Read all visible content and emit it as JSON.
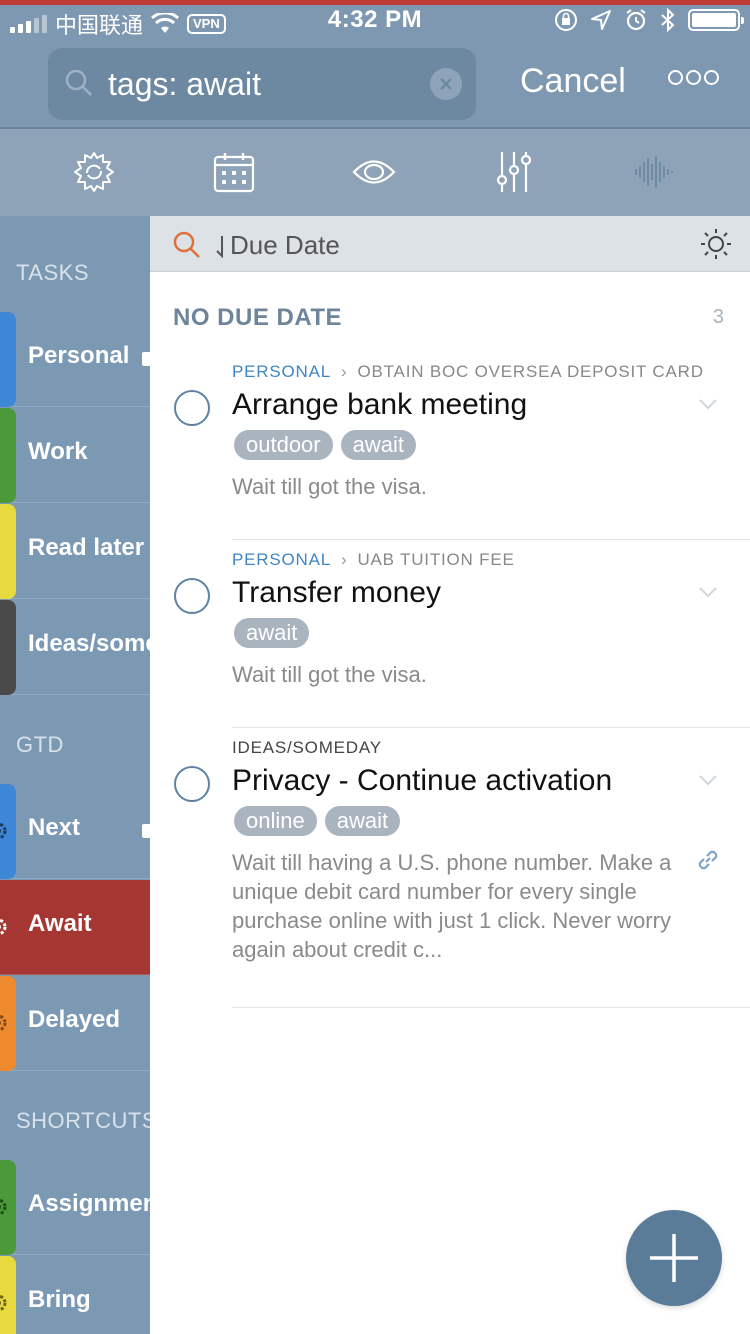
{
  "status_bar": {
    "carrier": "中国联通",
    "vpn": "VPN",
    "time": "4:32 PM"
  },
  "search": {
    "query": "tags: await",
    "cancel_label": "Cancel"
  },
  "toolbar": {
    "icons": [
      "sync-icon",
      "calendar-icon",
      "eye-icon",
      "sliders-icon",
      "waveform-icon"
    ]
  },
  "sidebar": {
    "tasks_header": "TASKS",
    "gtd_header": "GTD",
    "shortcuts_header": "SHORTCUTS",
    "items": [
      {
        "label": "Personal",
        "color": "#3d86d8"
      },
      {
        "label": "Work",
        "color": "#4a9a3a"
      },
      {
        "label": "Read later",
        "color": "#e8d93e"
      },
      {
        "label": "Ideas/someday",
        "color": "#4a4a4a"
      },
      {
        "label": "Next",
        "color": "#3d86d8"
      },
      {
        "label": "Await",
        "color": "#a63631"
      },
      {
        "label": "Delayed",
        "color": "#f08a2e"
      },
      {
        "label": "Assignments",
        "color": "#4a9a3a"
      },
      {
        "label": "Bring",
        "color": "#e8d93e"
      }
    ]
  },
  "sort": {
    "label": "Due Date"
  },
  "group": {
    "title": "NO DUE DATE",
    "count": "3"
  },
  "tasks": [
    {
      "project": "PERSONAL",
      "parent": "OBTAIN BOC OVERSEA DEPOSIT CARD",
      "title": "Arrange bank meeting",
      "tags": [
        "outdoor",
        "await"
      ],
      "note": "Wait till got the visa."
    },
    {
      "project": "PERSONAL",
      "parent": "UAB TUITION FEE",
      "title": "Transfer money",
      "tags": [
        "await"
      ],
      "note": "Wait till got the visa."
    },
    {
      "project": "IDEAS/SOMEDAY",
      "parent": "",
      "title": "Privacy - Continue activation",
      "tags": [
        "online",
        "await"
      ],
      "note": "Wait till having a U.S. phone number. Make a unique debit card number for every single purchase online with just 1 click. Never worry again about credit c..."
    }
  ],
  "colors": {
    "accent": "#5b7c99",
    "active_list": "#a63631",
    "project_link": "#3f86c6",
    "search_icon": "#e0703a"
  }
}
